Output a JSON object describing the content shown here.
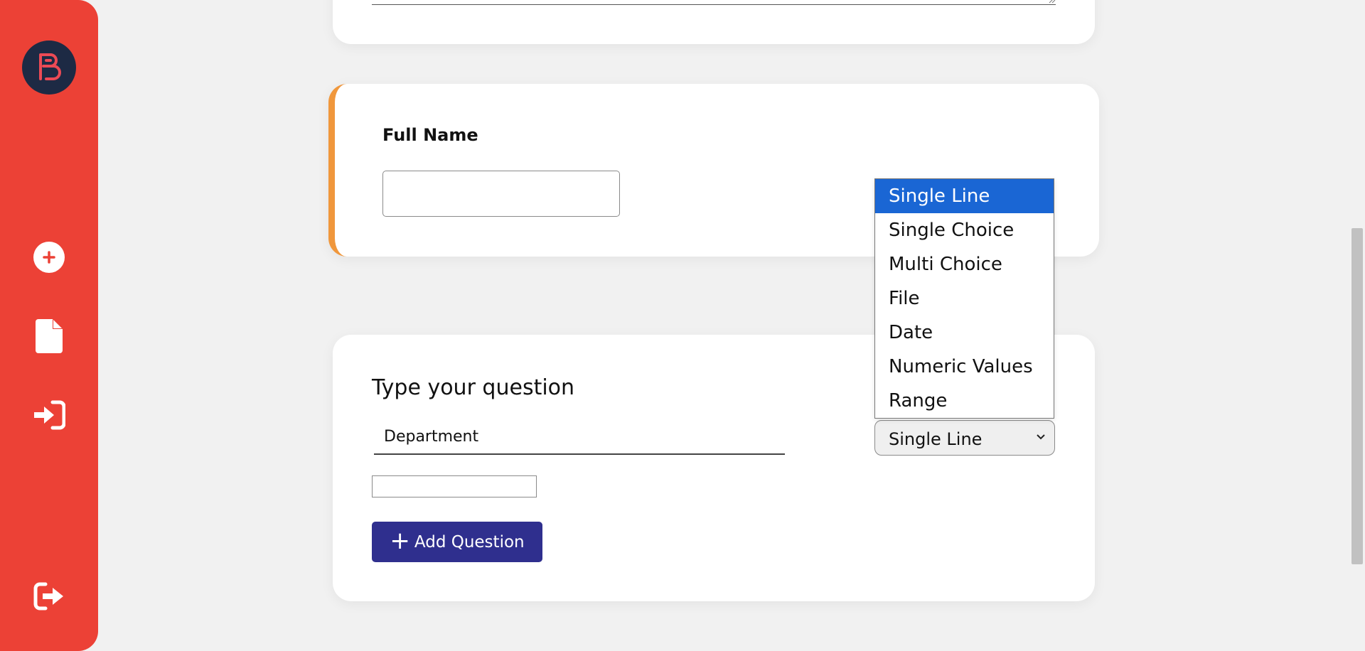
{
  "colors": {
    "sidebar": "#ec4136",
    "logo_bg": "#1d2a44",
    "accent_border": "#f0973c",
    "button": "#2f2f8e",
    "selected_option": "#1a66d4"
  },
  "sidebar": {
    "icons": [
      "brand-logo-icon",
      "add-icon",
      "document-icon",
      "sign-in-icon",
      "sign-out-icon"
    ]
  },
  "field_card": {
    "label": "Full Name"
  },
  "question_card": {
    "title": "Type your question",
    "question_value": "Department",
    "type_selected": "Single Line",
    "add_button_label": "Add Question"
  },
  "dropdown": {
    "options": [
      "Single Line",
      "Single Choice",
      "Multi Choice",
      "File",
      "Date",
      "Numeric Values",
      "Range"
    ],
    "selected_index": 0
  }
}
